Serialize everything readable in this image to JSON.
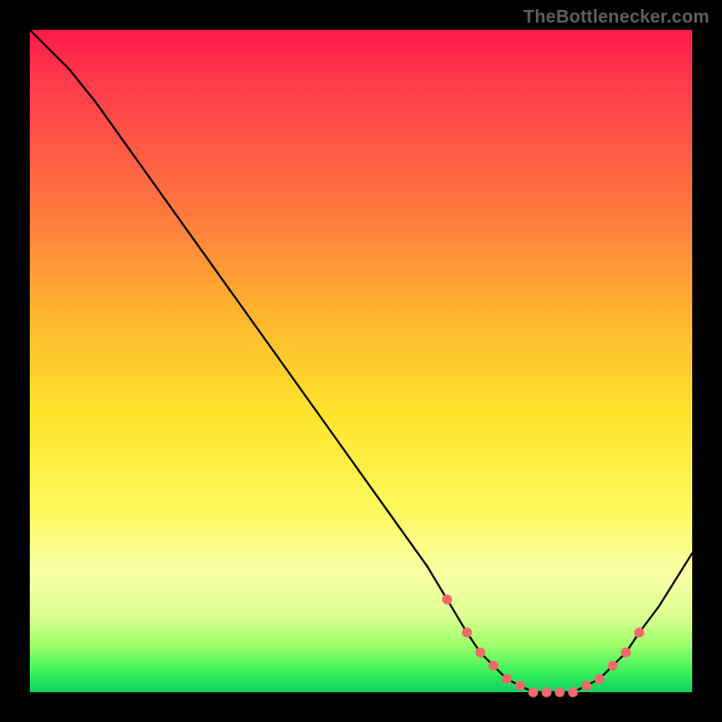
{
  "watermark": "TheBottlenecker.com",
  "colors": {
    "gradient_top": "#ff1a4a",
    "gradient_mid": "#ffe32c",
    "gradient_bottom": "#0ad163",
    "line": "#000000",
    "marker": "#f06a6a",
    "background": "#000000"
  },
  "chart_data": {
    "type": "line",
    "title": "",
    "xlabel": "",
    "ylabel": "",
    "xlim": [
      0,
      100
    ],
    "ylim": [
      0,
      100
    ],
    "grid": false,
    "legend": false,
    "x": [
      0,
      6,
      10,
      15,
      20,
      25,
      30,
      35,
      40,
      45,
      50,
      55,
      60,
      63,
      66,
      68,
      70,
      72,
      74,
      76,
      78,
      80,
      82,
      84,
      86,
      88,
      90,
      92,
      95,
      100
    ],
    "y": [
      100,
      94,
      89,
      82,
      75,
      68,
      61,
      54,
      47,
      40,
      33,
      26,
      19,
      14,
      9,
      6,
      4,
      2,
      1,
      0,
      0,
      0,
      0,
      1,
      2,
      4,
      6,
      9,
      13,
      21
    ],
    "markers": {
      "x": [
        63,
        66,
        68,
        70,
        72,
        74,
        76,
        78,
        80,
        82,
        84,
        86,
        88,
        90,
        92
      ],
      "y": [
        14,
        9,
        6,
        4,
        2,
        1,
        0,
        0,
        0,
        0,
        1,
        2,
        4,
        6,
        9
      ]
    },
    "annotations": []
  }
}
